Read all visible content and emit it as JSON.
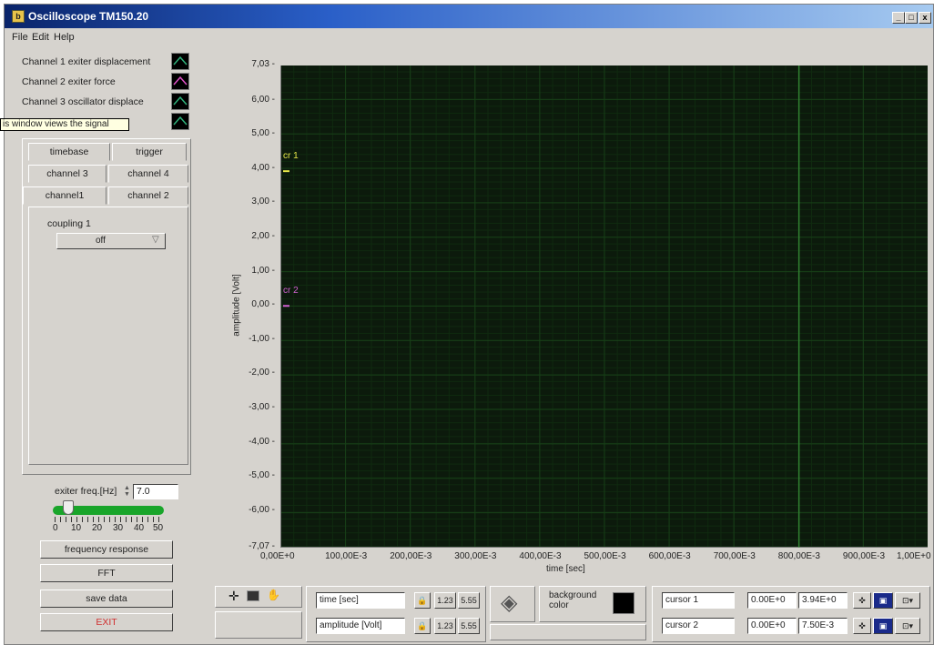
{
  "window": {
    "title": "Oscilloscope TM150.20",
    "icon_glyph": "b",
    "controls": {
      "minimize": "_",
      "maximize": "□",
      "close": "x"
    }
  },
  "menu": {
    "file": "File",
    "edit": "Edit",
    "help": "Help"
  },
  "legend": [
    {
      "label": "Channel 1 exiter displacement",
      "color": "#2fb07a"
    },
    {
      "label": "Channel 2 exiter force",
      "color": "#e050c8"
    },
    {
      "label": "Channel 3 oscillator displace",
      "color": "#2fb07a"
    },
    {
      "label": "",
      "color": "#2fb07a"
    }
  ],
  "tooltip": "is window views the signal",
  "tabs": {
    "timebase": "timebase",
    "trigger": "trigger",
    "channel3": "channel 3",
    "channel4": "channel 4",
    "channel1": "channel1",
    "channel2": "channel 2"
  },
  "coupling": {
    "label": "coupling 1",
    "value": "off"
  },
  "exciter": {
    "label": "exiter freq.[Hz]",
    "value": "7.0",
    "slider_value": 7,
    "slider_max": 50,
    "scale": [
      "0",
      "10",
      "20",
      "30",
      "40",
      "50"
    ]
  },
  "buttons": {
    "frequency_response": "frequency response",
    "fft": "FFT",
    "save_data": "save data",
    "exit": "EXIT"
  },
  "chart_data": {
    "type": "line",
    "xlabel": "time [sec]",
    "ylabel": "amplitude [Volt]",
    "xlim": [
      0,
      1.0
    ],
    "ylim": [
      -7.07,
      7.03
    ],
    "x_ticks": [
      "0,00E+0",
      "100,00E-3",
      "200,00E-3",
      "300,00E-3",
      "400,00E-3",
      "500,00E-3",
      "600,00E-3",
      "700,00E-3",
      "800,00E-3",
      "900,00E-3",
      "1,00E+0"
    ],
    "y_ticks": [
      "7,03",
      "6,00",
      "5,00",
      "4,00",
      "3,00",
      "2,00",
      "1,00",
      "0,00",
      "-1,00",
      "-2,00",
      "-3,00",
      "-4,00",
      "-5,00",
      "-6,00",
      "-7,07"
    ],
    "y_tick_values": [
      7.03,
      6,
      5,
      4,
      3,
      2,
      1,
      0,
      -1,
      -2,
      -3,
      -4,
      -5,
      -6,
      -7.07
    ],
    "grid": true,
    "highlight_x": 0.8,
    "cursors": [
      {
        "name": "cr 1",
        "x": 0.0,
        "y": 3.94,
        "color": "#e8e84a"
      },
      {
        "name": "cr 2",
        "x": 0.0,
        "y": 0.0,
        "color": "#d060d0"
      }
    ]
  },
  "toolbar": {
    "x_axis_label": "time [sec]",
    "y_axis_label": "amplitude [Volt]",
    "background_color_label": "background color",
    "cursor1": {
      "name": "cursor 1",
      "x": "0.00E+0",
      "y": "3.94E+0"
    },
    "cursor2": {
      "name": "cursor 2",
      "x": "0.00E+0",
      "y": "7.50E-3"
    },
    "fmt_a": "1.23",
    "fmt_b": "5.55",
    "fmt_c": "1.23",
    "fmt_d": "5.55"
  }
}
